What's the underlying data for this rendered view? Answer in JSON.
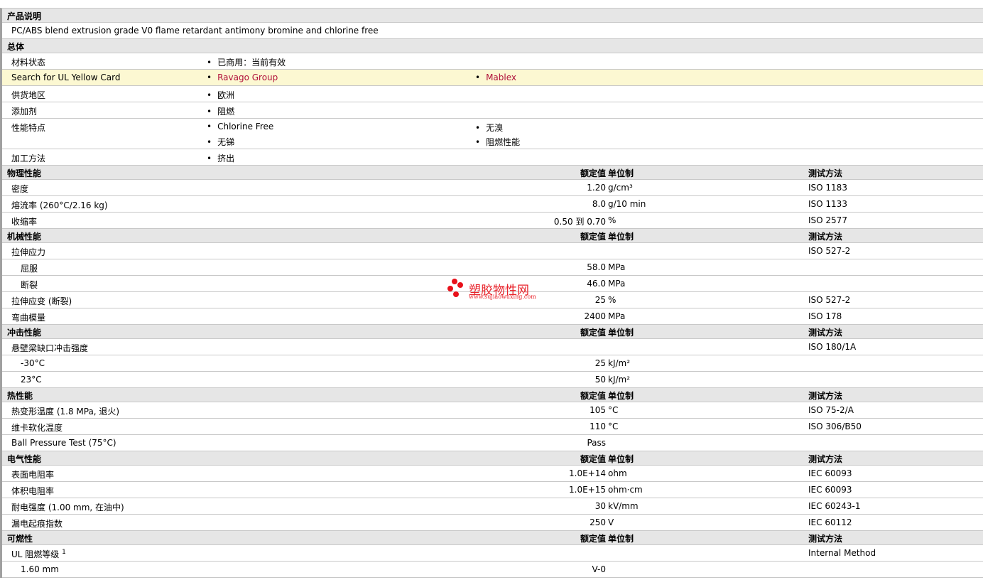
{
  "description": {
    "header": "产品说明",
    "text": "PC/ABS blend extrusion grade V0 flame retardant antimony bromine and chlorine free"
  },
  "general": {
    "header": "总体",
    "status_label": "材料状态",
    "status": "已商用：当前有效",
    "ul_label": "Search for UL Yellow Card",
    "ul_links": [
      "Ravago Group",
      "Mablex"
    ],
    "region_label": "供货地区",
    "region": "欧洲",
    "additive_label": "添加剂",
    "additive": "阻燃",
    "features_label": "性能特点",
    "features": [
      "Chlorine Free",
      "无溴",
      "无锑",
      "阻燃性能"
    ],
    "process_label": "加工方法",
    "process": "挤出"
  },
  "col_headers": {
    "value": "额定值",
    "unit": "单位制",
    "method": "测试方法"
  },
  "sections": [
    {
      "title": "物理性能",
      "rows": [
        {
          "label": "密度",
          "value": "1.20",
          "unit": "g/cm³",
          "method": "ISO 1183"
        },
        {
          "label": "熔流率 (260°C/2.16 kg)",
          "value": "8.0",
          "unit": "g/10 min",
          "method": "ISO 1133"
        },
        {
          "label": "收缩率",
          "value": "0.50 到  0.70",
          "unit": "%",
          "method": "ISO 2577"
        }
      ]
    },
    {
      "title": "机械性能",
      "rows": [
        {
          "label": "拉伸应力",
          "value": "",
          "unit": "",
          "method": "ISO 527-2"
        },
        {
          "label": "屈服",
          "value": "58.0",
          "unit": "MPa",
          "method": "",
          "indent": true
        },
        {
          "label": "断裂",
          "value": "46.0",
          "unit": "MPa",
          "method": "",
          "indent": true
        },
        {
          "label": "拉伸应变 (断裂)",
          "value": "25",
          "unit": "%",
          "method": "ISO 527-2"
        },
        {
          "label": "弯曲模量",
          "value": "2400",
          "unit": "MPa",
          "method": "ISO 178"
        }
      ]
    },
    {
      "title": "冲击性能",
      "rows": [
        {
          "label": "悬壁梁缺口冲击强度",
          "value": "",
          "unit": "",
          "method": "ISO 180/1A"
        },
        {
          "label": "-30°C",
          "value": "25",
          "unit": "kJ/m²",
          "method": "",
          "indent": true
        },
        {
          "label": "23°C",
          "value": "50",
          "unit": "kJ/m²",
          "method": "",
          "indent": true
        }
      ]
    },
    {
      "title": "热性能",
      "rows": [
        {
          "label": "热变形温度 (1.8 MPa, 退火)",
          "value": "105",
          "unit": "°C",
          "method": "ISO 75-2/A"
        },
        {
          "label": "维卡软化温度",
          "value": "110",
          "unit": "°C",
          "method": "ISO 306/B50"
        },
        {
          "label": "Ball Pressure Test (75°C)",
          "value": "Pass",
          "unit": "",
          "method": ""
        }
      ]
    },
    {
      "title": "电气性能",
      "rows": [
        {
          "label": "表面电阻率",
          "value": "1.0E+14",
          "unit": "ohm",
          "method": "IEC 60093"
        },
        {
          "label": "体积电阻率",
          "value": "1.0E+15",
          "unit": "ohm·cm",
          "method": "IEC 60093"
        },
        {
          "label": "耐电强度 (1.00 mm, 在油中)",
          "value": "30",
          "unit": "kV/mm",
          "method": "IEC 60243-1"
        },
        {
          "label": "漏电起痕指数",
          "value": "250",
          "unit": "V",
          "method": "IEC 60112"
        }
      ]
    },
    {
      "title": "可燃性",
      "rows": [
        {
          "label": "UL 阻燃等级",
          "sup": "1",
          "value": "",
          "unit": "",
          "method": "Internal Method"
        },
        {
          "label": "1.60 mm",
          "value": "V-0",
          "unit": "",
          "method": "",
          "indent": true
        }
      ]
    }
  ],
  "watermark": {
    "name": "塑胶物性网",
    "url": "www.sujiaowuxing.com"
  }
}
